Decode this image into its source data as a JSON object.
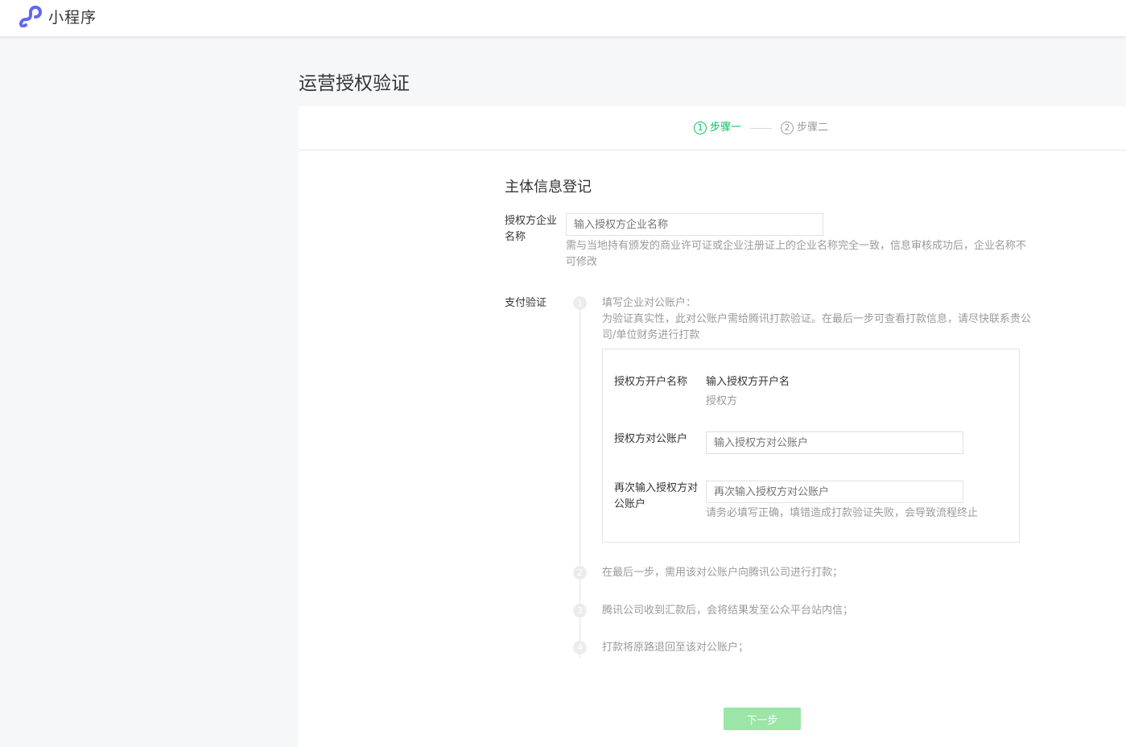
{
  "app": {
    "name": "小程序"
  },
  "page": {
    "title": "运营授权验证"
  },
  "steps": [
    {
      "num": "1",
      "label": "步骤一",
      "active": true
    },
    {
      "num": "2",
      "label": "步骤二",
      "active": false
    }
  ],
  "colors": {
    "accent": "#07c160",
    "button": "#9be5a7",
    "logo": "#6467f0"
  },
  "form": {
    "section_title": "主体信息登记",
    "company": {
      "label_line1": "授权方企业",
      "label_line2": "名称",
      "placeholder": "输入授权方企业名称",
      "hint_line1": "需与当地持有颁发的商业许可证或企业注册证上的企业名称完全一致，信息审核成功后，企业名称不",
      "hint_line2": "可修改"
    },
    "payment": {
      "label": "支付验证",
      "step1": {
        "num": "1",
        "title": "填写企业对公账户：",
        "desc_line1": "为验证真实性，此对公账户需给腾讯打款验证。在最后一步可查看打款信息，请尽快联系贵公",
        "desc_line2": "司/单位财务进行打款"
      },
      "account_name": {
        "label": "授权方开户名称",
        "value": "输入授权方开户名",
        "hint": "授权方"
      },
      "account_no": {
        "label": "授权方对公账户",
        "placeholder": "输入授权方对公账户"
      },
      "account_confirm": {
        "label_line1": "再次输入授权方对",
        "label_line2": "公账户",
        "placeholder": "再次输入授权方对公账户",
        "hint": "请务必填写正确，填错造成打款验证失败，会导致流程终止"
      },
      "step2": {
        "num": "2",
        "text": "在最后一步，需用该对公账户向腾讯公司进行打款；"
      },
      "step3": {
        "num": "3",
        "text": "腾讯公司收到汇款后，会将结果发至公众平台站内信；"
      },
      "step4": {
        "num": "4",
        "text": "打款将原路退回至该对公账户；"
      }
    },
    "next_label": "下一步"
  }
}
